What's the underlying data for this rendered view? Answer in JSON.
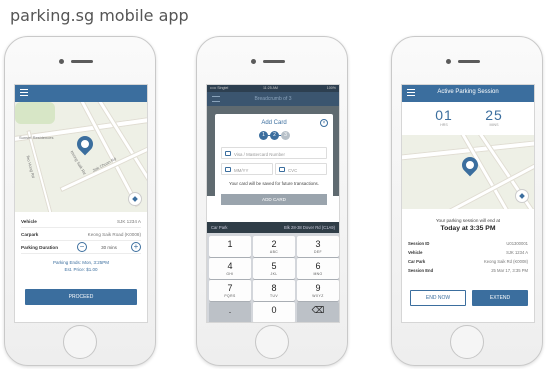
{
  "slide": {
    "title": "parking.sg mobile app"
  },
  "screen1": {
    "rows": [
      {
        "label": "Vehicle",
        "value": "SJK 1234 A"
      },
      {
        "label": "Carpark",
        "value": "Keong Saik Road (K0008)"
      },
      {
        "label": "Parking Duration",
        "value": "30 mins"
      }
    ],
    "parking_end": "Parking Ends: Mon, 3:25PM",
    "est_price": "Est. Price: $1.00",
    "proceed_label": "PROCEED",
    "map_labels": [
      "Sunset Residences",
      "Teo Hong Rd",
      "Keong Saik Rd",
      "Jiak Chuan Rd"
    ]
  },
  "screen2": {
    "status_left": "••••• Singtel",
    "status_time": "11:25 AM",
    "status_right": "100%",
    "bar_title": "Breadcrumb of 3",
    "dialog_title": "Add Card",
    "steps": [
      "1",
      "2",
      "3"
    ],
    "card_placeholder": "Visa / Mastercard Number",
    "expiry_placeholder": "MM/YY",
    "cvc_placeholder": "CVC",
    "hint": "Your card will be saved for future transactions.",
    "add_card_label": "ADD CARD",
    "carpark_label": "Car Park",
    "carpark_value": "Blk 28-38 Dover Rd (C1A9)",
    "keys": [
      {
        "n": "1",
        "l": ""
      },
      {
        "n": "2",
        "l": "ABC"
      },
      {
        "n": "3",
        "l": "DEF"
      },
      {
        "n": "4",
        "l": "GHI"
      },
      {
        "n": "5",
        "l": "JKL"
      },
      {
        "n": "6",
        "l": "MNO"
      },
      {
        "n": "7",
        "l": "PQRS"
      },
      {
        "n": "8",
        "l": "TUV"
      },
      {
        "n": "9",
        "l": "WXYZ"
      },
      {
        "n": ".",
        "l": ""
      },
      {
        "n": "0",
        "l": ""
      },
      {
        "n": "⌫",
        "l": ""
      }
    ]
  },
  "screen3": {
    "bar_title": "Active Parking Session",
    "hrs": "01",
    "hrs_unit": "HRS",
    "mins": "25",
    "mins_unit": "MINS",
    "ends_label": "Your parking session will end at",
    "ends_time": "Today at 3:35 PM",
    "rows": [
      {
        "label": "Session ID",
        "value": "U01300001"
      },
      {
        "label": "Vehicle",
        "value": "SJK 1234 A"
      },
      {
        "label": "Car Park",
        "value": "Keong Saik Rd (K0008)"
      },
      {
        "label": "Session End",
        "value": "25 Mar 17, 3:35 PM"
      }
    ],
    "end_now_label": "END NOW",
    "extend_label": "EXTEND"
  },
  "colors": {
    "accent": "#3b6e9e",
    "keypad": "#d3d6db"
  }
}
